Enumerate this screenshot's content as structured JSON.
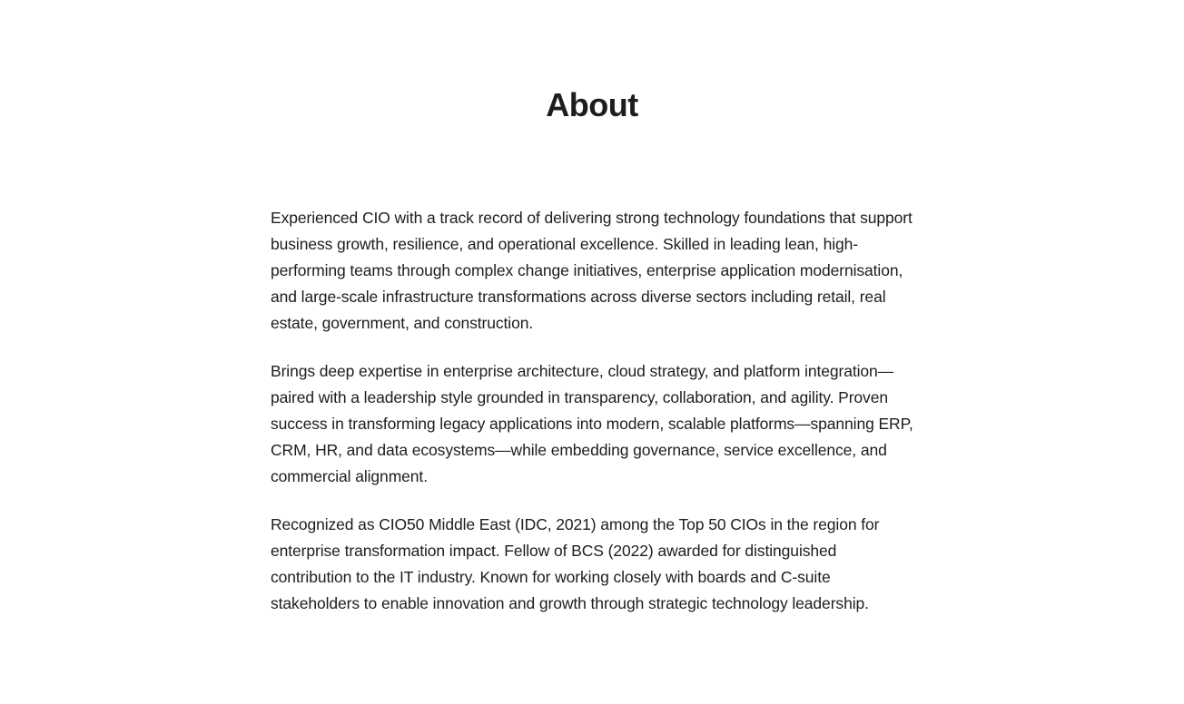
{
  "page": {
    "title": "About"
  },
  "paragraphs": [
    "Experienced CIO with a track record of delivering strong technology foundations that support business growth, resilience, and operational excellence. Skilled in leading lean, high-performing teams through complex change initiatives, enterprise application modernisation, and large-scale infrastructure transformations across diverse sectors including retail, real estate, government, and construction.",
    "Brings deep expertise in enterprise architecture, cloud strategy, and platform integration—paired with a leadership style grounded in transparency, collaboration, and agility. Proven success in transforming legacy applications into modern, scalable platforms—spanning ERP, CRM, HR, and data ecosystems—while embedding governance, service excellence, and commercial alignment.",
    "Recognized as CIO50 Middle East (IDC, 2021) among the Top 50 CIOs in the region for enterprise transformation impact. Fellow of BCS (2022) awarded for distinguished contribution to the IT industry. Known for working closely with boards and C-suite stakeholders to enable innovation and growth through strategic technology leadership."
  ]
}
